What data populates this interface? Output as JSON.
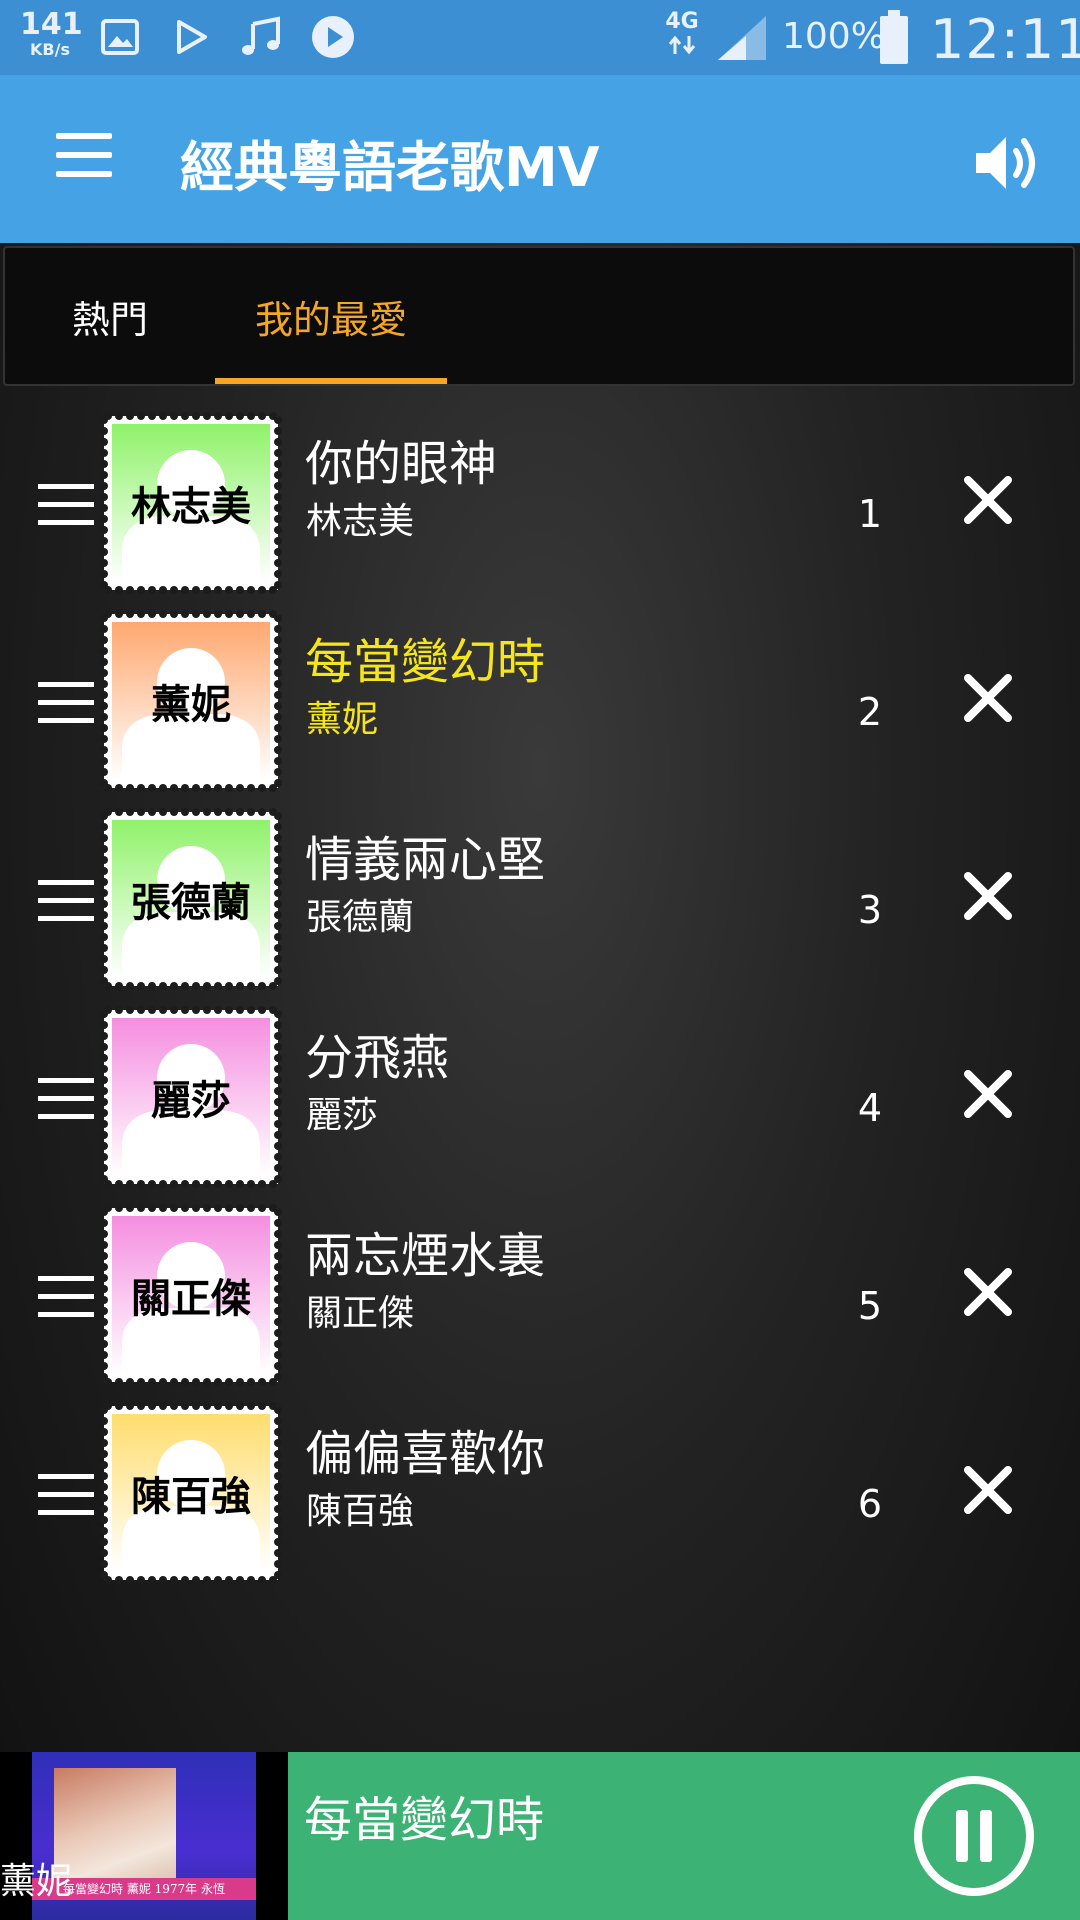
{
  "status_bar": {
    "net_speed_value": "141",
    "net_speed_unit": "KB/s",
    "network": "4G",
    "battery_pct": "100%",
    "time": "12:11",
    "notification_icons": [
      "image-icon",
      "play-store-icon",
      "music-note-icon",
      "video-play-icon"
    ]
  },
  "app_bar": {
    "title": "經典粵語老歌MV",
    "menu_icon": "menu-icon",
    "volume_icon": "volume-icon"
  },
  "tabs": [
    {
      "label": "熱門",
      "selected": false
    },
    {
      "label": "我的最愛",
      "selected": true
    }
  ],
  "songs": [
    {
      "title": "你的眼神",
      "artist": "林志美",
      "stamp_name": "林志美",
      "index": "1",
      "stamp_color": "#8ff26a",
      "active": false
    },
    {
      "title": "每當變幻時",
      "artist": "薰妮",
      "stamp_name": "薰妮",
      "index": "2",
      "stamp_color": "#ffa870",
      "active": true
    },
    {
      "title": "情義兩心堅",
      "artist": "張德蘭",
      "stamp_name": "張德蘭",
      "index": "3",
      "stamp_color": "#8ff26a",
      "active": false
    },
    {
      "title": "分飛燕",
      "artist": "麗莎",
      "stamp_name": "麗莎",
      "index": "4",
      "stamp_color": "#f58ee0",
      "active": false
    },
    {
      "title": "兩忘煙水裏",
      "artist": "關正傑",
      "stamp_name": "關正傑",
      "index": "5",
      "stamp_color": "#f58ee0",
      "active": false
    },
    {
      "title": "偏偏喜歡你",
      "artist": "陳百強",
      "stamp_name": "陳百強",
      "index": "6",
      "stamp_color": "#ffdd6e",
      "active": false
    }
  ],
  "now_playing": {
    "title": "每當變幻時",
    "artist": "薰妮",
    "thumb_caption": "每當變幻時 薰妮 1977年 永恆",
    "control_icon": "pause-icon"
  },
  "colors": {
    "status_bar": "#3c8fd2",
    "app_bar": "#45a3e5",
    "tab_accent": "#f5a623",
    "active_song": "#f5e51b",
    "player_bar": "#3cb374"
  }
}
